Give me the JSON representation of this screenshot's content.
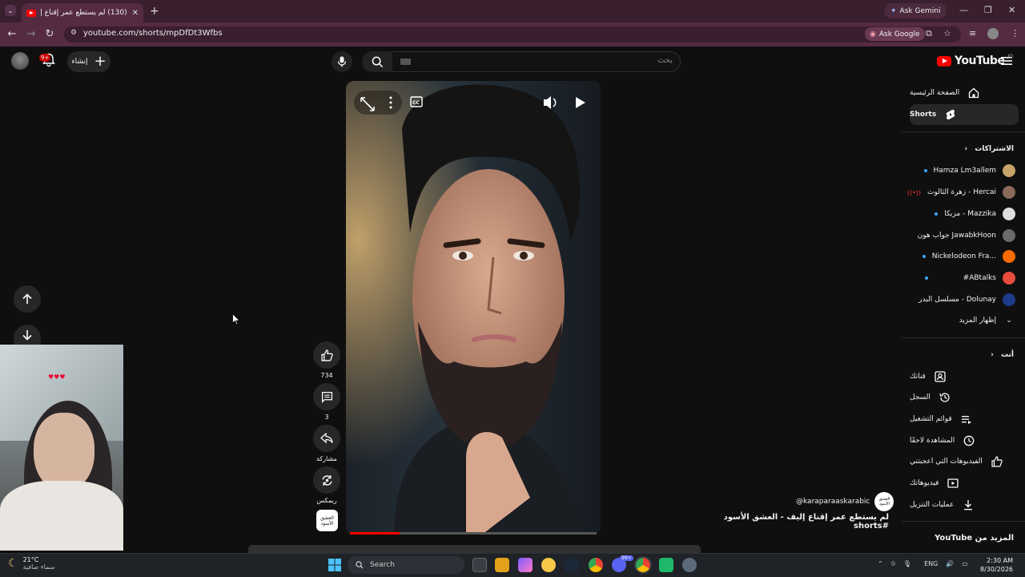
{
  "browser": {
    "tab_title": "(130) لم يستطع عمر إقناع إليف -",
    "url": "youtube.com/shorts/mpDfDt3Wfbs",
    "ask_gemini": "Ask Gemini",
    "ask_google": "Ask Google"
  },
  "header": {
    "logo_text": "YouTube",
    "country_code": "JO",
    "search_placeholder": "بحث",
    "create_label": "إنشاء",
    "notifications_badge": "9+"
  },
  "sidebar": {
    "main": [
      {
        "label": "الصفحة الرئيسية",
        "icon": "home-icon"
      },
      {
        "label": "Shorts",
        "icon": "shorts-icon",
        "active": true
      }
    ],
    "subscriptions_heading": "الاشتراكات",
    "subscriptions": [
      {
        "label": "Hamza Lm3allem",
        "color": "#c9a46a"
      },
      {
        "label": "زهرة الثالوث - Hercai",
        "color": "#8a6a5a"
      },
      {
        "label": "مزيكا - Mazzika",
        "color": "#dddddd"
      },
      {
        "label": "جواب هون JawabkHoon",
        "color": "#6b6b6b"
      },
      {
        "label": "Nickelodeon Fra...",
        "color": "#ff6a00"
      },
      {
        "label": "#ABtalks",
        "color": "#e84c3d"
      },
      {
        "label": "مسلسل البدر - Dolunay",
        "color": "#1d3b8a"
      }
    ],
    "show_more": "إظهار المزيد",
    "you_heading": "أنت",
    "you_items": [
      {
        "label": "قناتك",
        "icon": "channel-icon"
      },
      {
        "label": "السجل",
        "icon": "history-icon"
      },
      {
        "label": "قوائم التشغيل",
        "icon": "playlists-icon"
      },
      {
        "label": "المشاهدة لاحقًا",
        "icon": "watch-later-icon"
      },
      {
        "label": "الفيديوهات التي أعجبتني",
        "icon": "liked-videos-icon"
      },
      {
        "label": "فيديوهاتك",
        "icon": "your-videos-icon"
      },
      {
        "label": "عمليات التنزيل",
        "icon": "downloads-icon"
      }
    ],
    "more_from": "المزيد من YouTube"
  },
  "short": {
    "channel_handle": "@karaparaaskarabic",
    "channel_avatar_text": "العشق الأسود",
    "title": "لم يستطع عمر إقناع إليف - العشق الأسود #shorts",
    "progress": 0.2,
    "likes": "734",
    "comments": "3",
    "share_label": "مشاركة",
    "remix_label": "ريمكس",
    "sound_text": "العشق الأسود"
  },
  "taskbar": {
    "temperature": "21°C",
    "weather": "سماء صافية",
    "search": "Search",
    "language": "ENG",
    "time": "2:30 AM",
    "date": "8/30/2026",
    "chat_badge": "99+"
  }
}
